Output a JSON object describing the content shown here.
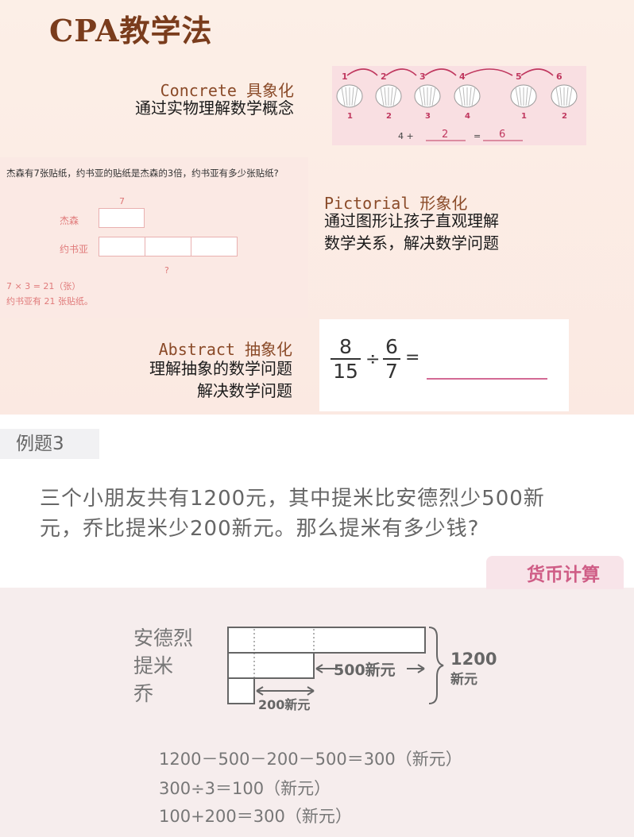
{
  "title": "CPA教学法",
  "concrete": {
    "label": "Concrete 具象化",
    "desc": "通过实物理解数学概念",
    "top_numbers": [
      "1",
      "2",
      "3",
      "4",
      "5",
      "6"
    ],
    "bottom_numbers": [
      "1",
      "2",
      "3",
      "4",
      "1",
      "2"
    ],
    "equation": {
      "a": "4 +",
      "b": "2",
      "eq": "=",
      "c": "6"
    }
  },
  "pictorial": {
    "label": "Pictorial 形象化",
    "desc_lines": [
      "通过图形让孩子直观理解",
      "数学关系，解决数学问题"
    ],
    "problem": "杰森有7张贴纸，约书亚的贴纸是杰森的3倍，约书亚有多少张贴纸?",
    "row1": "杰森",
    "row2": "约书亚",
    "top_label": "7",
    "bottom_label": "?",
    "calc": "7 × 3 = 21（张）",
    "answer": "约书亚有 21 张贴纸。"
  },
  "abstract": {
    "label": "Abstract 抽象化",
    "desc_lines": [
      "理解抽象的数学问题",
      "解决数学问题"
    ],
    "n1": "8",
    "d1": "15",
    "op": "÷",
    "n2": "6",
    "d2": "7",
    "eq": "="
  },
  "example": {
    "label": "例题3",
    "problem_lines": [
      "三个小朋友共有1200元，其中提米比安德烈少500新",
      "元，乔比提米少200新元。那么提米有多少钱?"
    ],
    "tag": "货币计算",
    "names": [
      "安德烈",
      "提米",
      "乔"
    ],
    "diff1": "500新元",
    "diff2": "200新元",
    "total1": "1200",
    "total2": "新元",
    "equations": [
      "1200－500－200－500＝300（新元）",
      "300÷3＝100（新元）",
      "100+200＝300（新元）"
    ]
  },
  "colors": {
    "title": "#7a3c1c",
    "accent": "#cf5d86",
    "pink_text": "#e07a7a"
  }
}
